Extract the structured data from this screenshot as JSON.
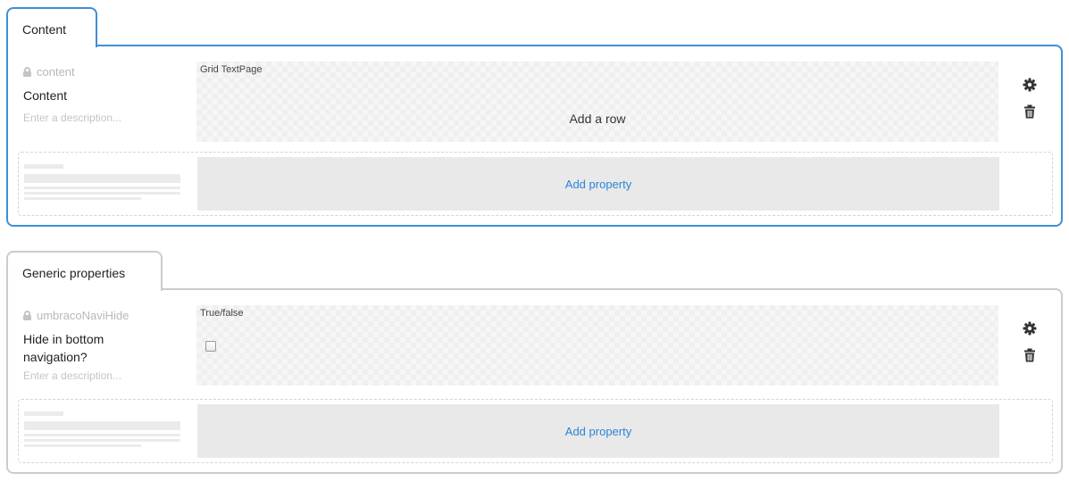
{
  "groups": [
    {
      "tab_label": "Content",
      "property": {
        "alias": "content",
        "name": "Content",
        "description_placeholder": "Enter a description...",
        "editor_label": "Grid TextPage",
        "add_row_label": "Add a row"
      },
      "add_property_label": "Add property"
    },
    {
      "tab_label": "Generic properties",
      "property": {
        "alias": "umbracoNaviHide",
        "name": "Hide in bottom navigation?",
        "description_placeholder": "Enter a description...",
        "editor_label": "True/false",
        "checkbox_checked": false
      },
      "add_property_label": "Add property"
    }
  ],
  "icons": {
    "settings": "gear-icon",
    "delete": "trash-icon",
    "locked": "lock-icon"
  },
  "colors": {
    "active_border": "#3f8ed9",
    "inactive_border": "#cccccc",
    "link": "#2b84d8"
  }
}
